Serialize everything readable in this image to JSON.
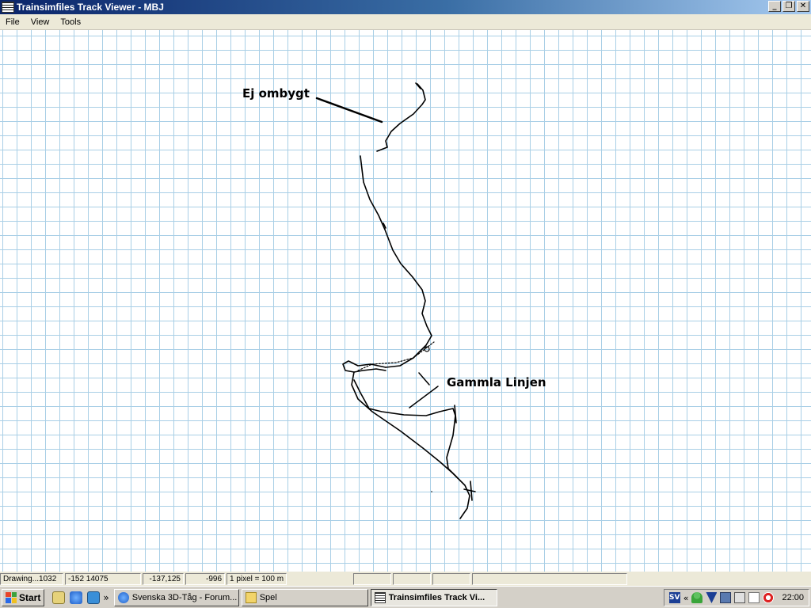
{
  "window": {
    "title": "Trainsimfiles Track Viewer - MBJ"
  },
  "menu": {
    "items": [
      "File",
      "View",
      "Tools"
    ]
  },
  "annotations": {
    "top_label": "Ej ombygt",
    "bottom_label": "Gammla Linjen"
  },
  "status": {
    "drawing": "Drawing...1032",
    "coord1": "-152 14075",
    "coord2": "-137,125",
    "coord3": "-996",
    "scale": "1 pixel = 100 m"
  },
  "taskbar": {
    "start_label": "Start",
    "chevron": "»",
    "tasks": [
      "Svenska 3D-Tåg - Forum...",
      "Spel",
      "Trainsimfiles Track Vi..."
    ],
    "tray_chevron": "«",
    "language": "SV",
    "clock": "22:00"
  },
  "colors": {
    "grid": "#a9cfe6",
    "track": "#000000",
    "titlebar": "#0a246a",
    "taskbar": "#d4d0c8"
  },
  "icons": [
    "window-app-icon",
    "minimize-icon",
    "restore-icon",
    "close-icon",
    "windows-logo-icon",
    "show-desktop-icon",
    "ie-icon",
    "media-icon",
    "ie-page-icon",
    "folder-icon",
    "app-icon",
    "user-icon",
    "network-icon",
    "shield-icon",
    "mail-icon",
    "lifebuoy-icon"
  ]
}
